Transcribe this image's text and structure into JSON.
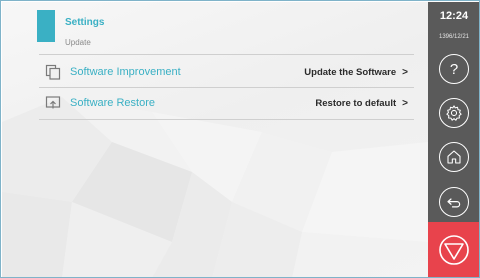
{
  "header": {
    "title": "Settings",
    "subtitle": "Update"
  },
  "rows": [
    {
      "label": "Software Improvement",
      "action": "Update the Software",
      "chevron": ">",
      "icon": "copy-icon"
    },
    {
      "label": "Software Restore",
      "action": "Restore to default",
      "chevron": ">",
      "icon": "restore-icon"
    }
  ],
  "sidebar": {
    "time": "12:24",
    "date": "1396/12/21",
    "help_glyph": "?",
    "buttons": [
      "help-icon",
      "gear-icon",
      "home-icon",
      "back-arrow-icon",
      "stop-icon"
    ]
  },
  "colors": {
    "accent": "#3ab0c4",
    "sidebar": "#5a5a5a",
    "stop": "#e8434c"
  }
}
